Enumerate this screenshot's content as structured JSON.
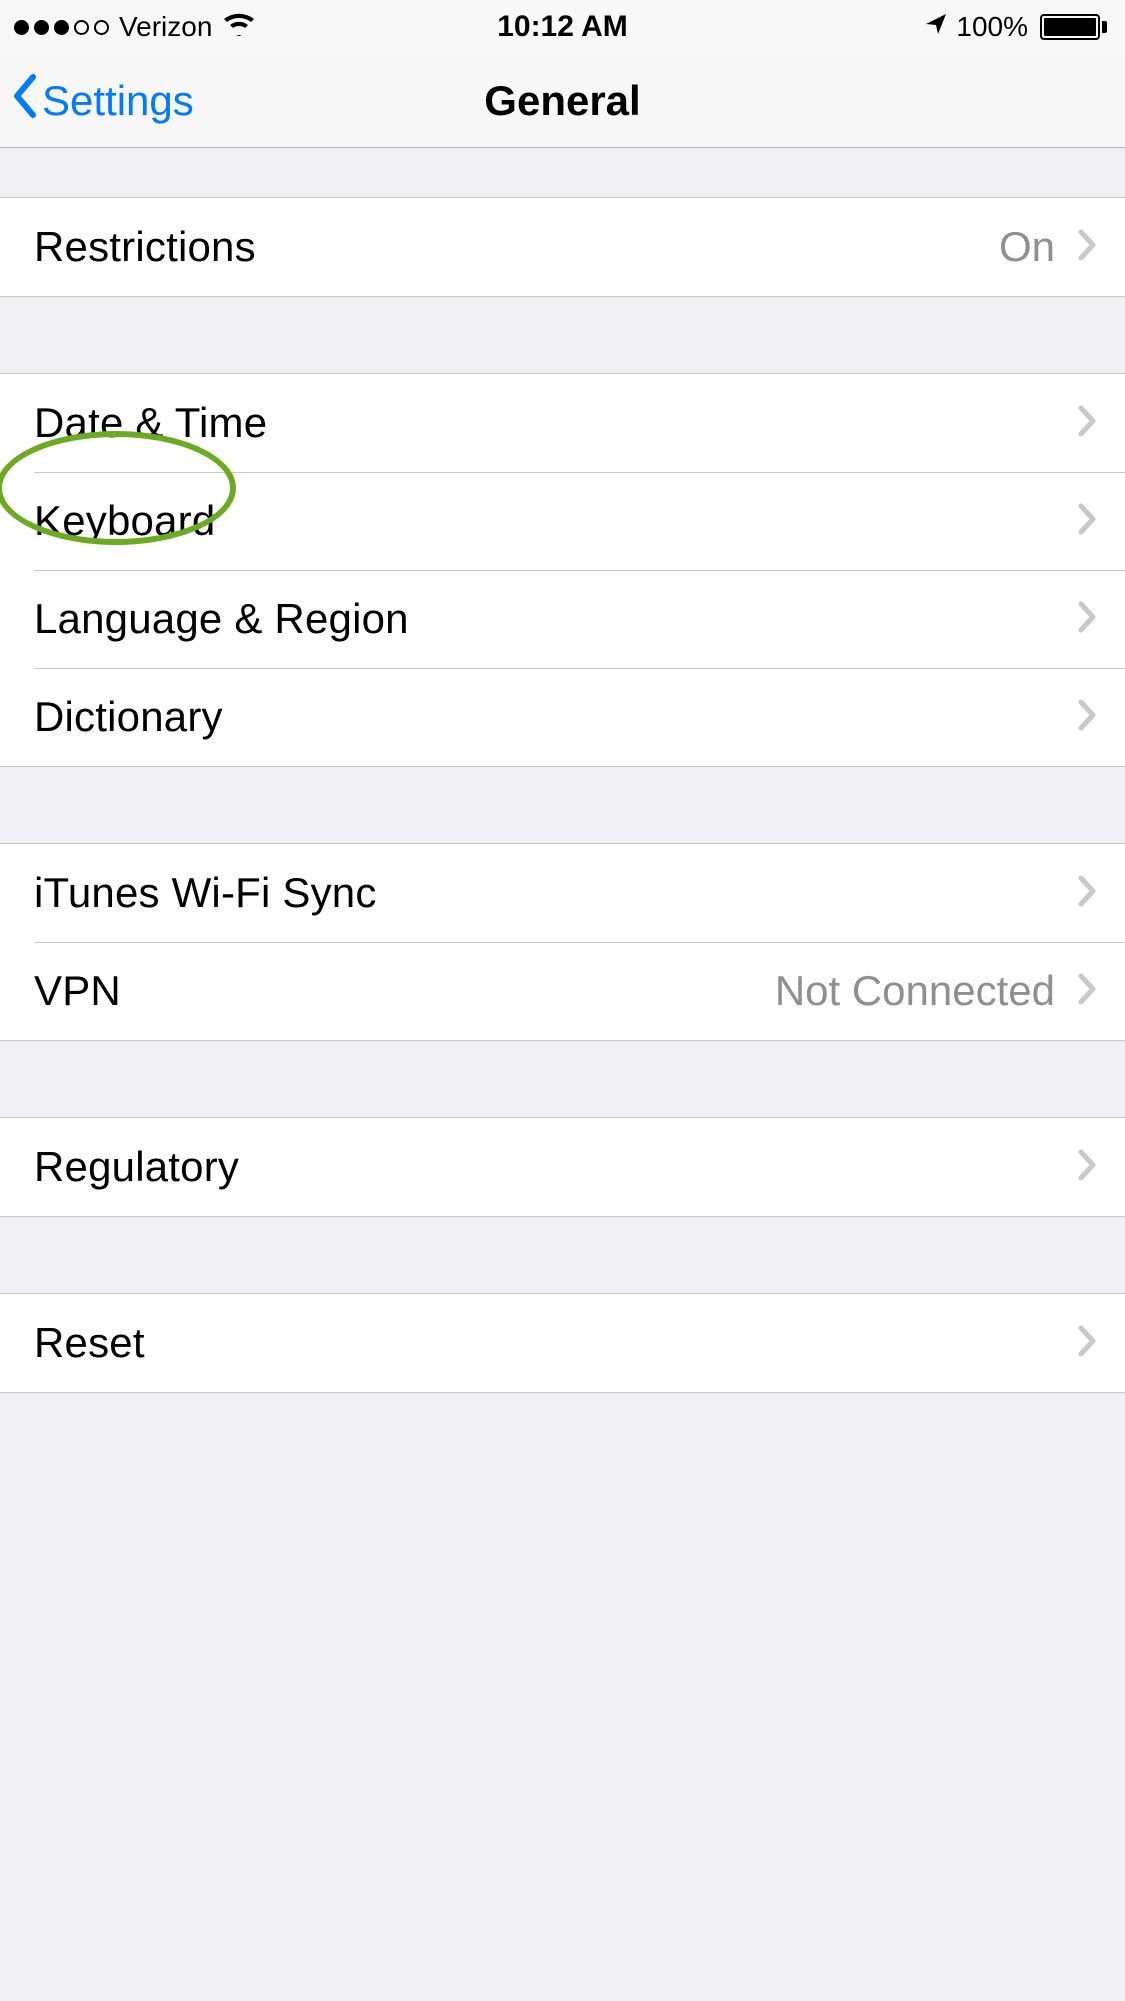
{
  "statusbar": {
    "carrier": "Verizon",
    "time": "10:12 AM",
    "battery_pct": "100%"
  },
  "nav": {
    "back": "Settings",
    "title": "General"
  },
  "groups": [
    {
      "rows": [
        {
          "label": "Restrictions",
          "value": "On"
        }
      ]
    },
    {
      "rows": [
        {
          "label": "Date & Time",
          "value": ""
        },
        {
          "label": "Keyboard",
          "value": ""
        },
        {
          "label": "Language & Region",
          "value": ""
        },
        {
          "label": "Dictionary",
          "value": ""
        }
      ]
    },
    {
      "rows": [
        {
          "label": "iTunes Wi-Fi Sync",
          "value": ""
        },
        {
          "label": "VPN",
          "value": "Not Connected"
        }
      ]
    },
    {
      "rows": [
        {
          "label": "Regulatory",
          "value": ""
        }
      ]
    },
    {
      "rows": [
        {
          "label": "Reset",
          "value": ""
        }
      ]
    }
  ],
  "annotation": {
    "highlighted_row": "Keyboard"
  }
}
